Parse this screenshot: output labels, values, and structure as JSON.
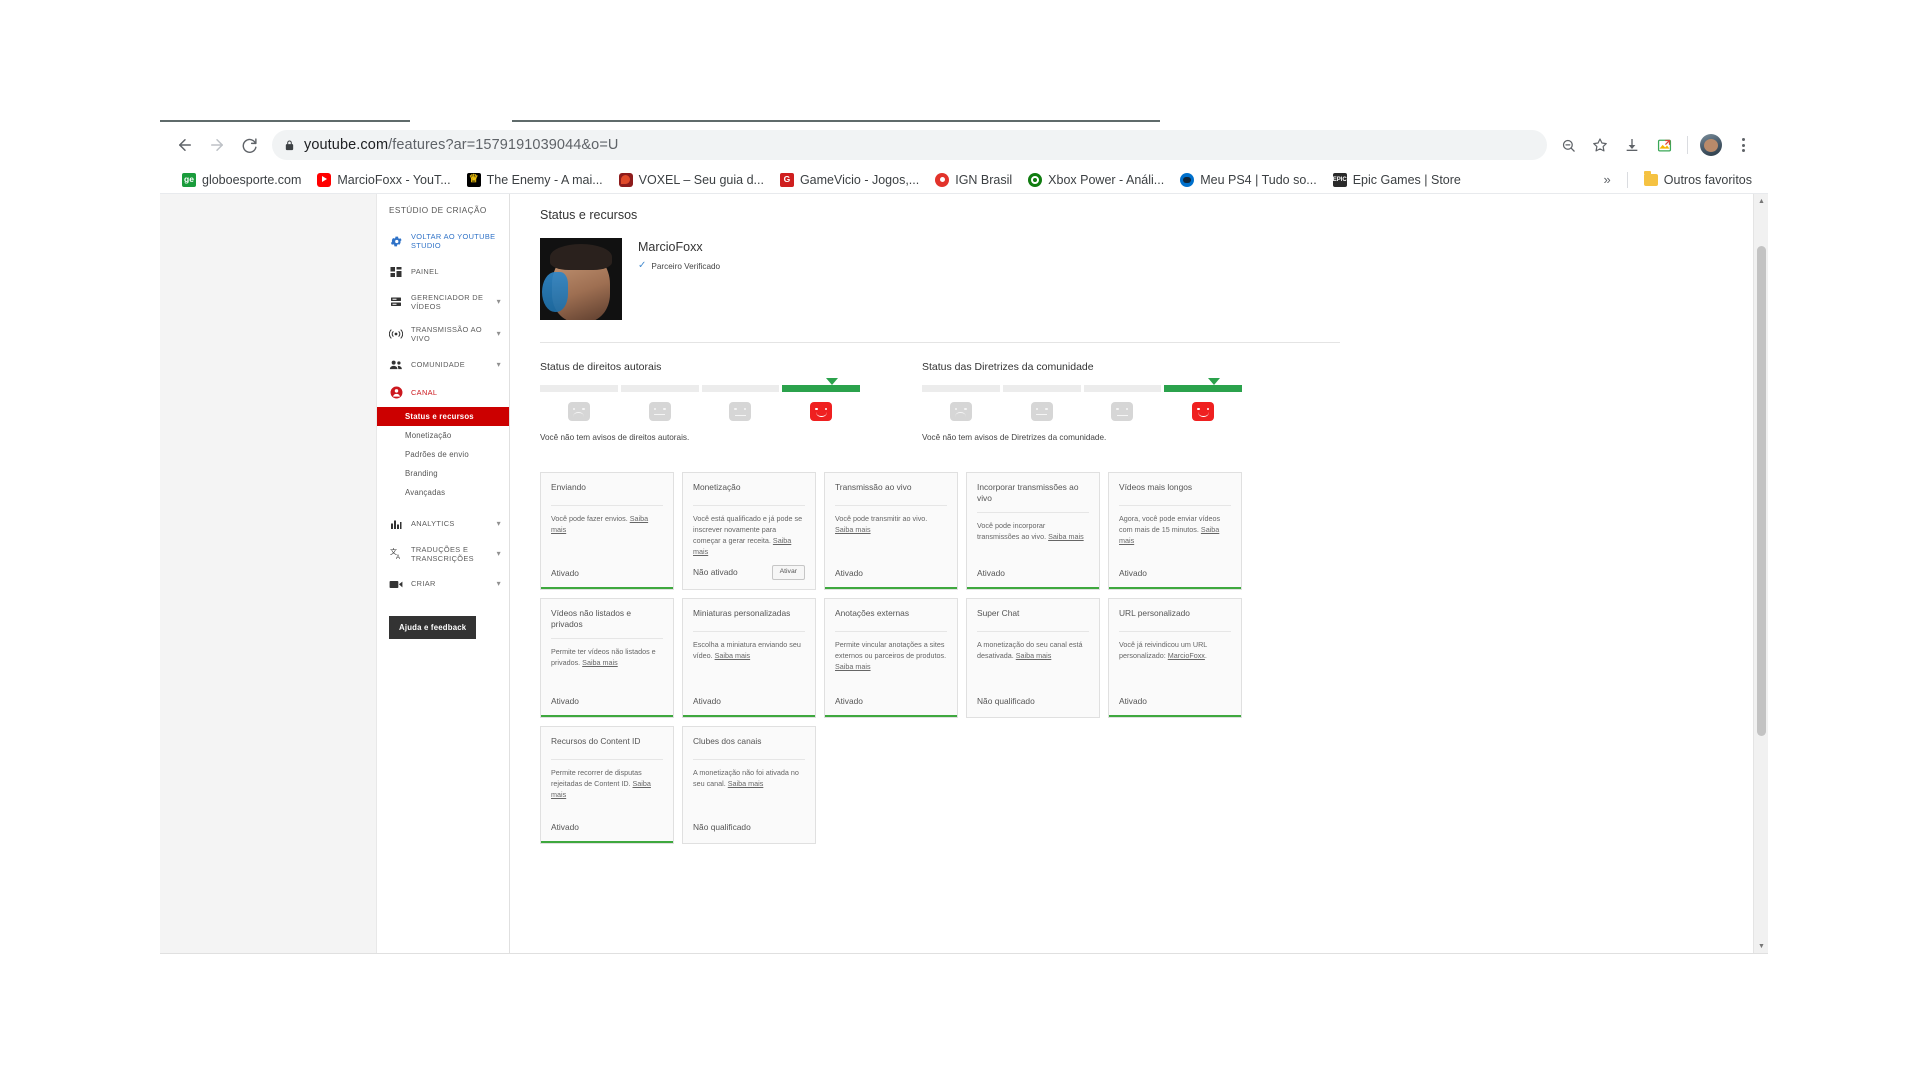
{
  "browser": {
    "back_label": "back-arrow",
    "forward_label": "forward-arrow",
    "reload_label": "reload",
    "url_host": "youtube.com",
    "url_path": "/features?ar=1579191039044&o=U",
    "url_full": "youtube.com/features?ar=1579191039044&o=U",
    "toolbar_icons": [
      "zoom-out-icon",
      "bookmark-star-icon",
      "download-icon",
      "image-extension-icon",
      "profile-avatar",
      "chrome-menu-icon"
    ],
    "bookmarks": [
      {
        "label": "globoesporte.com",
        "favicon": "globo-icon",
        "glyph": "ge"
      },
      {
        "label": "MarcioFoxx - YouT...",
        "favicon": "youtube-icon",
        "glyph": ""
      },
      {
        "label": "The Enemy - A mai...",
        "favicon": "the-enemy-icon",
        "glyph": "♟"
      },
      {
        "label": "VOXEL – Seu guia d...",
        "favicon": "voxel-icon",
        "glyph": ""
      },
      {
        "label": "GameVicio - Jogos,...",
        "favicon": "gamevicio-icon",
        "glyph": "G"
      },
      {
        "label": "IGN Brasil",
        "favicon": "ign-icon",
        "glyph": ""
      },
      {
        "label": "Xbox Power - Análi...",
        "favicon": "xbox-icon",
        "glyph": ""
      },
      {
        "label": "Meu PS4 | Tudo so...",
        "favicon": "ps4-icon",
        "glyph": ""
      },
      {
        "label": "Epic Games | Store",
        "favicon": "epic-icon",
        "glyph": "EPIC"
      }
    ],
    "overflow_label": "»",
    "other_bookmarks_label": "Outros favoritos"
  },
  "sidebar": {
    "header": "ESTÚDIO DE CRIAÇÃO",
    "items": [
      {
        "label": "VOLTAR AO YOUTUBE STUDIO",
        "icon": "gear-icon",
        "chevron": false,
        "accent": false
      },
      {
        "label": "PAINEL",
        "icon": "dashboard-icon",
        "chevron": false,
        "accent": false
      },
      {
        "label": "GERENCIADOR DE VÍDEOS",
        "icon": "video-manager-icon",
        "chevron": true,
        "accent": false
      },
      {
        "label": "TRANSMISSÃO AO VIVO",
        "icon": "live-broadcast-icon",
        "chevron": true,
        "accent": false
      },
      {
        "label": "COMUNIDADE",
        "icon": "people-icon",
        "chevron": true,
        "accent": false
      },
      {
        "label": "CANAL",
        "icon": "channel-account-icon",
        "chevron": false,
        "accent": true
      }
    ],
    "sub_items": [
      {
        "label": "Status e recursos",
        "active": true
      },
      {
        "label": "Monetização",
        "active": false
      },
      {
        "label": "Padrões de envio",
        "active": false
      },
      {
        "label": "Branding",
        "active": false
      },
      {
        "label": "Avançadas",
        "active": false
      }
    ],
    "items_after": [
      {
        "label": "ANALYTICS",
        "icon": "analytics-bars-icon",
        "chevron": true,
        "accent": false
      },
      {
        "label": "TRADUÇÕES E TRANSCRIÇÕES",
        "icon": "translate-icon",
        "chevron": true,
        "accent": false
      },
      {
        "label": "CRIAR",
        "icon": "create-camera-icon",
        "chevron": true,
        "accent": false
      }
    ],
    "help_button": "Ajuda e feedback"
  },
  "main": {
    "page_title": "Status e recursos",
    "channel": {
      "name": "MarcioFoxx",
      "verified_label": "Parceiro Verificado",
      "check_glyph": "✓"
    },
    "status_blocks": [
      {
        "title": "Status de direitos autorais",
        "note": "Você não tem avisos de direitos autorais.",
        "segments": [
          false,
          false,
          false,
          true
        ],
        "active_index": 3
      },
      {
        "title": "Status das Diretrizes da comunidade",
        "note": "Você não tem avisos de Diretrizes da comunidade.",
        "segments": [
          false,
          false,
          false,
          true
        ],
        "active_index": 3
      }
    ],
    "cards": [
      {
        "title": "Enviando",
        "desc": "Você pode fazer envios. ",
        "link": "Saiba mais",
        "desc_tail": "",
        "status": "Ativado",
        "enabled": true,
        "button": null
      },
      {
        "title": "Monetização",
        "desc": "Você está qualificado e já pode se inscrever novamente para começar a gerar receita. ",
        "link": "Saiba mais",
        "desc_tail": "",
        "status": "Não ativado",
        "enabled": false,
        "button": "Ativar"
      },
      {
        "title": "Transmissão ao vivo",
        "desc": "Você pode transmitir ao vivo. ",
        "link": "Saiba mais",
        "desc_tail": "",
        "status": "Ativado",
        "enabled": true,
        "button": null
      },
      {
        "title": "Incorporar transmissões ao vivo",
        "desc": "Você pode incorporar transmissões ao vivo. ",
        "link": "Saiba mais",
        "desc_tail": "",
        "status": "Ativado",
        "enabled": true,
        "button": null
      },
      {
        "title": "Vídeos mais longos",
        "desc": "Agora, você pode enviar vídeos com mais de 15 minutos. ",
        "link": "Saiba mais",
        "desc_tail": "",
        "status": "Ativado",
        "enabled": true,
        "button": null
      },
      {
        "title": "Vídeos não listados e privados",
        "desc": "Permite ter vídeos não listados e privados. ",
        "link": "Saiba mais",
        "desc_tail": "",
        "status": "Ativado",
        "enabled": true,
        "button": null
      },
      {
        "title": "Miniaturas personalizadas",
        "desc": "Escolha a miniatura enviando seu vídeo. ",
        "link": "Saiba mais",
        "desc_tail": "",
        "status": "Ativado",
        "enabled": true,
        "button": null
      },
      {
        "title": "Anotações externas",
        "desc": "Permite vincular anotações a sites externos ou parceiros de produtos. ",
        "link": "Saiba mais",
        "desc_tail": "",
        "status": "Ativado",
        "enabled": true,
        "button": null
      },
      {
        "title": "Super Chat",
        "desc": "A monetização do seu canal está desativada. ",
        "link": "Saiba mais",
        "desc_tail": "",
        "status": "Não qualificado",
        "enabled": false,
        "button": null
      },
      {
        "title": "URL personalizado",
        "desc": "Você já reivindicou um URL personalizado: ",
        "link": "MarcioFoxx",
        "desc_tail": ".",
        "status": "Ativado",
        "enabled": true,
        "button": null
      },
      {
        "title": "Recursos do Content ID",
        "desc": "Permite recorrer de disputas rejeitadas de Content ID. ",
        "link": "Saiba mais",
        "desc_tail": "",
        "status": "Ativado",
        "enabled": true,
        "button": null
      },
      {
        "title": "Clubes dos canais",
        "desc": "A monetização não foi ativada no seu canal. ",
        "link": "Saiba mais",
        "desc_tail": "",
        "status": "Não qualificado",
        "enabled": false,
        "button": null
      }
    ]
  },
  "colors": {
    "youtube_red": "#cc0000",
    "green_ok": "#3ea83e",
    "meter_green": "#2ba24c",
    "face_active_red": "#ef2020"
  }
}
